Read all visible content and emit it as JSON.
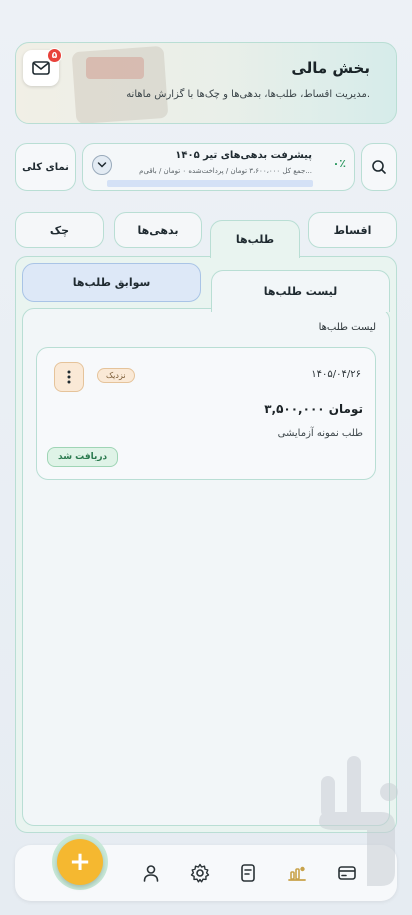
{
  "header": {
    "title": "بخش مالی",
    "subtitle": "مدیریت اقساط، طلب‌ها، بدهی‌ها و چک‌ها با گزارش ماهانه.",
    "notification_count": "۵"
  },
  "toolbar": {
    "overview_label": "نمای کلی"
  },
  "progress": {
    "title": "پیشرفت بدهی‌های تیر ۱۴۰۵",
    "percent_label": "۰٪",
    "detail": "جمع کل ۳،۶۰۰،۰۰۰ تومان / پرداخت‌شده ۰ تومان / باقی‌م...",
    "value": 0
  },
  "tabs": {
    "aqsat": "اقساط",
    "talab": "طلب‌ها",
    "bedehi": "بدهی‌ها",
    "chek": "چک"
  },
  "subtabs": {
    "list": "لیست طلب‌ها",
    "history": "سوابق طلب‌ها"
  },
  "list": {
    "section_label": "لیست طلب‌ها",
    "items": [
      {
        "date": "۱۴۰۵/۰۴/۲۶",
        "badge": "نزدیک",
        "amount": "۳,۵۰۰,۰۰۰ تومان",
        "description": "طلب نمونه آزمایشی",
        "status": "دریافت شد"
      }
    ]
  },
  "fab": {
    "label": "+"
  },
  "colors": {
    "accent_green": "#2f9a63",
    "border": "#b9ded4",
    "fab": "#f5b830",
    "badge_red": "#e8423b"
  }
}
